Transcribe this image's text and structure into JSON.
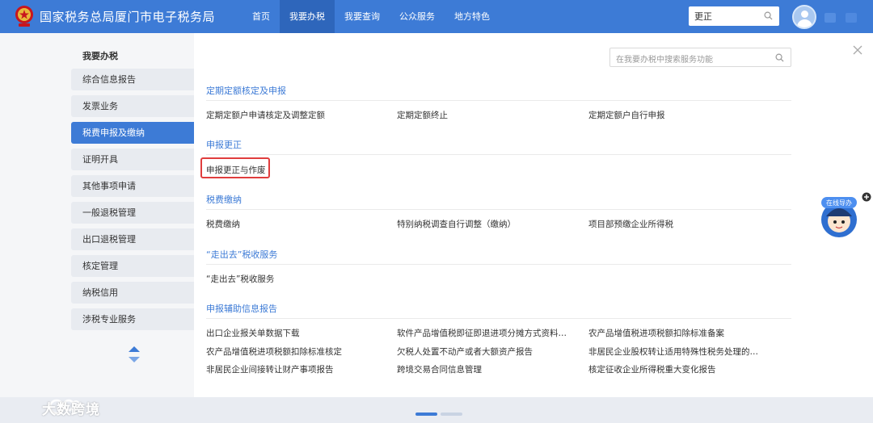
{
  "header": {
    "site_title": "国家税务总局厦门市电子税务局",
    "nav": [
      {
        "label": "首页",
        "active": false
      },
      {
        "label": "我要办税",
        "active": true
      },
      {
        "label": "我要查询",
        "active": false
      },
      {
        "label": "公众服务",
        "active": false
      },
      {
        "label": "地方特色",
        "active": false
      }
    ],
    "search_value": "更正"
  },
  "sidebar": {
    "title": "我要办税",
    "items": [
      {
        "label": "综合信息报告",
        "active": false
      },
      {
        "label": "发票业务",
        "active": false
      },
      {
        "label": "税费申报及缴纳",
        "active": true
      },
      {
        "label": "证明开具",
        "active": false
      },
      {
        "label": "其他事项申请",
        "active": false
      },
      {
        "label": "一般退税管理",
        "active": false
      },
      {
        "label": "出口退税管理",
        "active": false
      },
      {
        "label": "核定管理",
        "active": false
      },
      {
        "label": "纳税信用",
        "active": false
      },
      {
        "label": "涉税专业服务",
        "active": false
      }
    ]
  },
  "main": {
    "search_placeholder": "在我要办税中搜索服务功能",
    "sections": [
      {
        "title": "定期定额核定及申报",
        "rows": [
          [
            "定期定额户申请核定及调整定额",
            "定期定额终止",
            "定期定额户自行申报"
          ]
        ]
      },
      {
        "title": "申报更正",
        "rows": [
          [
            "申报更正与作废"
          ]
        ]
      },
      {
        "title": "税费缴纳",
        "rows": [
          [
            "税费缴纳",
            "特别纳税调查自行调整（缴纳）",
            "项目部预缴企业所得税"
          ]
        ]
      },
      {
        "title": "“走出去”税收服务",
        "rows": [
          [
            "“走出去”税收服务"
          ]
        ]
      },
      {
        "title": "申报辅助信息报告",
        "rows": [
          [
            "出口企业报关单数据下载",
            "软件产品增值税即征即退进项分摊方式资料…",
            "农产品增值税进项税额扣除标准备案"
          ],
          [
            "农产品增值税进项税额扣除标准核定",
            "欠税人处置不动产或者大额资产报告",
            "非居民企业股权转让适用特殊性税务处理的…"
          ],
          [
            "非居民企业间接转让财产事项报告",
            "跨境交易合同信息管理",
            "核定征收企业所得税重大变化报告"
          ]
        ]
      }
    ]
  },
  "mascot_label": "在线导办",
  "watermark": "大数跨境",
  "colors": {
    "primary": "#3d7bd6",
    "highlight": "#e03d3d"
  }
}
